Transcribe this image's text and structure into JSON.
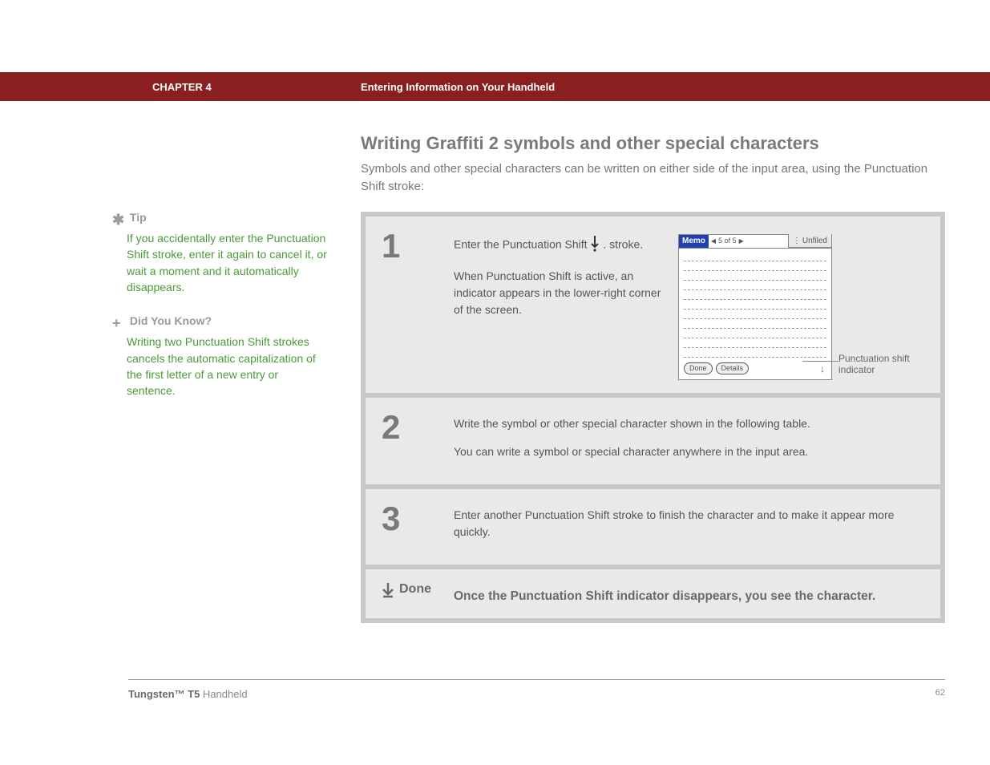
{
  "header": {
    "chapter": "CHAPTER 4",
    "title": "Entering Information on Your Handheld"
  },
  "section": {
    "title": "Writing Graffiti 2 symbols and other special characters",
    "intro": "Symbols and other special characters can be written on either side of the input area, using the Punctuation Shift stroke:"
  },
  "sidebar": {
    "tip": {
      "heading": "Tip",
      "body": "If you accidentally enter the Punctuation Shift stroke, enter it again to cancel it, or wait a moment and it automatically disappears."
    },
    "dyk": {
      "heading": "Did You Know?",
      "body": "Writing two Punctuation Shift strokes cancels the automatic capitalization of the first letter of a new entry or sentence."
    }
  },
  "steps": {
    "s1": {
      "num": "1",
      "p1a": "Enter the Punctuation Shift ",
      "p1b": ". stroke.",
      "p2": "When Punctuation Shift is active, an indicator appears in the lower-right corner of the screen.",
      "callout": "Punctuation shift indicator"
    },
    "s2": {
      "num": "2",
      "p1": "Write the symbol or other special character shown in the following table.",
      "p2": "You can write a symbol or special character anywhere in the input area."
    },
    "s3": {
      "num": "3",
      "p1": "Enter another Punctuation Shift stroke to finish the character and to make it appear more quickly."
    },
    "done": {
      "label": "Done",
      "text": "Once the Punctuation Shift indicator disappears, you see the character."
    }
  },
  "palm": {
    "memo": "Memo",
    "count": "5 of 5",
    "unfiled": "Unfiled",
    "done": "Done",
    "details": "Details"
  },
  "footer": {
    "product_bold": "Tungsten™ T5",
    "product_rest": " Handheld",
    "page": "62"
  }
}
